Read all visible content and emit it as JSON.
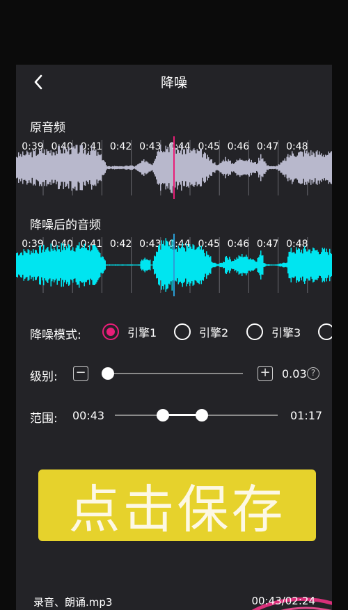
{
  "header": {
    "title": "降噪"
  },
  "original": {
    "label": "原音频",
    "times": [
      "0:39",
      "0:40",
      "0:41",
      "0:42",
      "0:43",
      "0:44",
      "0:45",
      "0:46",
      "0:47",
      "0:48"
    ],
    "wave_color": "#b8b8cc",
    "playhead_color": "#e91e78"
  },
  "denoised": {
    "label": "降噪后的音频",
    "times": [
      "0:39",
      "0:40",
      "0:41",
      "0:42",
      "0:43",
      "0:44",
      "0:45",
      "0:46",
      "0:47",
      "0:48"
    ],
    "wave_color": "#00e5f0",
    "playhead_color": "#2b9fd6"
  },
  "mode": {
    "label": "降噪模式:",
    "options": [
      "引擎1",
      "引擎2",
      "引擎3",
      ""
    ],
    "selected_index": 0,
    "accent": "#e91e78"
  },
  "level": {
    "label": "级别:",
    "minus": "−",
    "plus": "+",
    "value": "0.03",
    "help": "?",
    "fraction": 0.0
  },
  "range": {
    "label": "范围:",
    "start": "00:43",
    "end": "01:17"
  },
  "save": {
    "label": "点击保存",
    "color": "#e6d22c"
  },
  "footer": {
    "filename": "录音、朗诵.mp3",
    "time": "00:43/02:24"
  }
}
